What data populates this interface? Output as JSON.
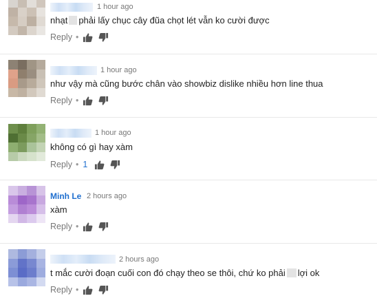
{
  "comments": [
    {
      "author": "",
      "time": "1 hour ago",
      "text_before": "nhạt",
      "text_after": "phải lấy chục cây đũa chọt lét vẫn ko cười được",
      "reply_label": "Reply",
      "separator": "•",
      "likes": "",
      "avatar_colors": [
        "#d8d4cf",
        "#c8beb3",
        "#e2ded9",
        "#d0c6bc",
        "#bfb2a5",
        "#d9d1c8",
        "#ccc1b5",
        "#e7e3de",
        "#c6b9ab",
        "#d6cdc3",
        "#bdb0a2",
        "#e0dad3",
        "#d3cac0",
        "#c2b6a9",
        "#dcd5cd",
        "#e9e6e2"
      ],
      "icons": [
        "thumbs-up-icon",
        "thumbs-down-icon"
      ]
    },
    {
      "author": "",
      "time": "1 hour ago",
      "text": "như vậy mà cũng bước chân vào showbiz dislike nhiều hơn line thua",
      "reply_label": "Reply",
      "separator": "•",
      "likes": "",
      "avatar_colors": [
        "#8d8274",
        "#7a6e60",
        "#a09585",
        "#b5aa9c",
        "#e0a28a",
        "#8f7f6d",
        "#9a8e80",
        "#c9c0b4",
        "#d99b82",
        "#a89a8a",
        "#b8ab9b",
        "#cfc6ba",
        "#c8b8a6",
        "#bfb1a1",
        "#d2c8bc",
        "#e0dad2"
      ],
      "icons": [
        "thumbs-up-icon",
        "thumbs-down-icon"
      ]
    },
    {
      "author": "",
      "time": "1 hour ago",
      "text": "không có gì hay xàm",
      "reply_label": "Reply",
      "separator": "•",
      "likes": "1",
      "avatar_colors": [
        "#6e8f4c",
        "#5f7f3d",
        "#7fa05c",
        "#93b274",
        "#4f6f33",
        "#6a8a48",
        "#86a566",
        "#a3bd88",
        "#8eae70",
        "#7c9b5e",
        "#aac39a",
        "#c3d4b5",
        "#b7cba8",
        "#cbd9bf",
        "#d6e2cc",
        "#e2eadb"
      ],
      "icons": [
        "thumbs-up-icon",
        "thumbs-down-icon"
      ]
    },
    {
      "author": "Minh Le",
      "time": "2 hours ago",
      "text": "xàm",
      "reply_label": "Reply",
      "separator": "•",
      "likes": "",
      "avatar_colors": [
        "#d9c6ea",
        "#c9aee0",
        "#b893d6",
        "#d7c3e8",
        "#b98cd8",
        "#9e66c8",
        "#a874cd",
        "#c8a8e0",
        "#c49ee0",
        "#b080d2",
        "#bb8cd9",
        "#d6bfe9",
        "#e4d6f0",
        "#d1b8e6",
        "#dccaee",
        "#eee5f6"
      ],
      "icons": [
        "thumbs-up-icon",
        "thumbs-down-icon"
      ]
    },
    {
      "author": "",
      "time": "2 hours ago",
      "text_before": "t mắc cười đoạn cuối con đó chạy theo se thôi, chứ ko phải",
      "text_after": "lợi ok",
      "reply_label": "Reply",
      "separator": "•",
      "likes": "",
      "avatar_colors": [
        "#aeb9e0",
        "#8c9cd6",
        "#a4b0de",
        "#c4cdea",
        "#8b9bd8",
        "#6273c8",
        "#7888d0",
        "#a8b4e2",
        "#7d8fd4",
        "#5a6cc6",
        "#6c7dcc",
        "#9eacdf",
        "#b7c2e8",
        "#9aa9de",
        "#aab6e3",
        "#d3daf1"
      ],
      "icons": [
        "thumbs-up-icon",
        "thumbs-down-icon"
      ]
    }
  ]
}
